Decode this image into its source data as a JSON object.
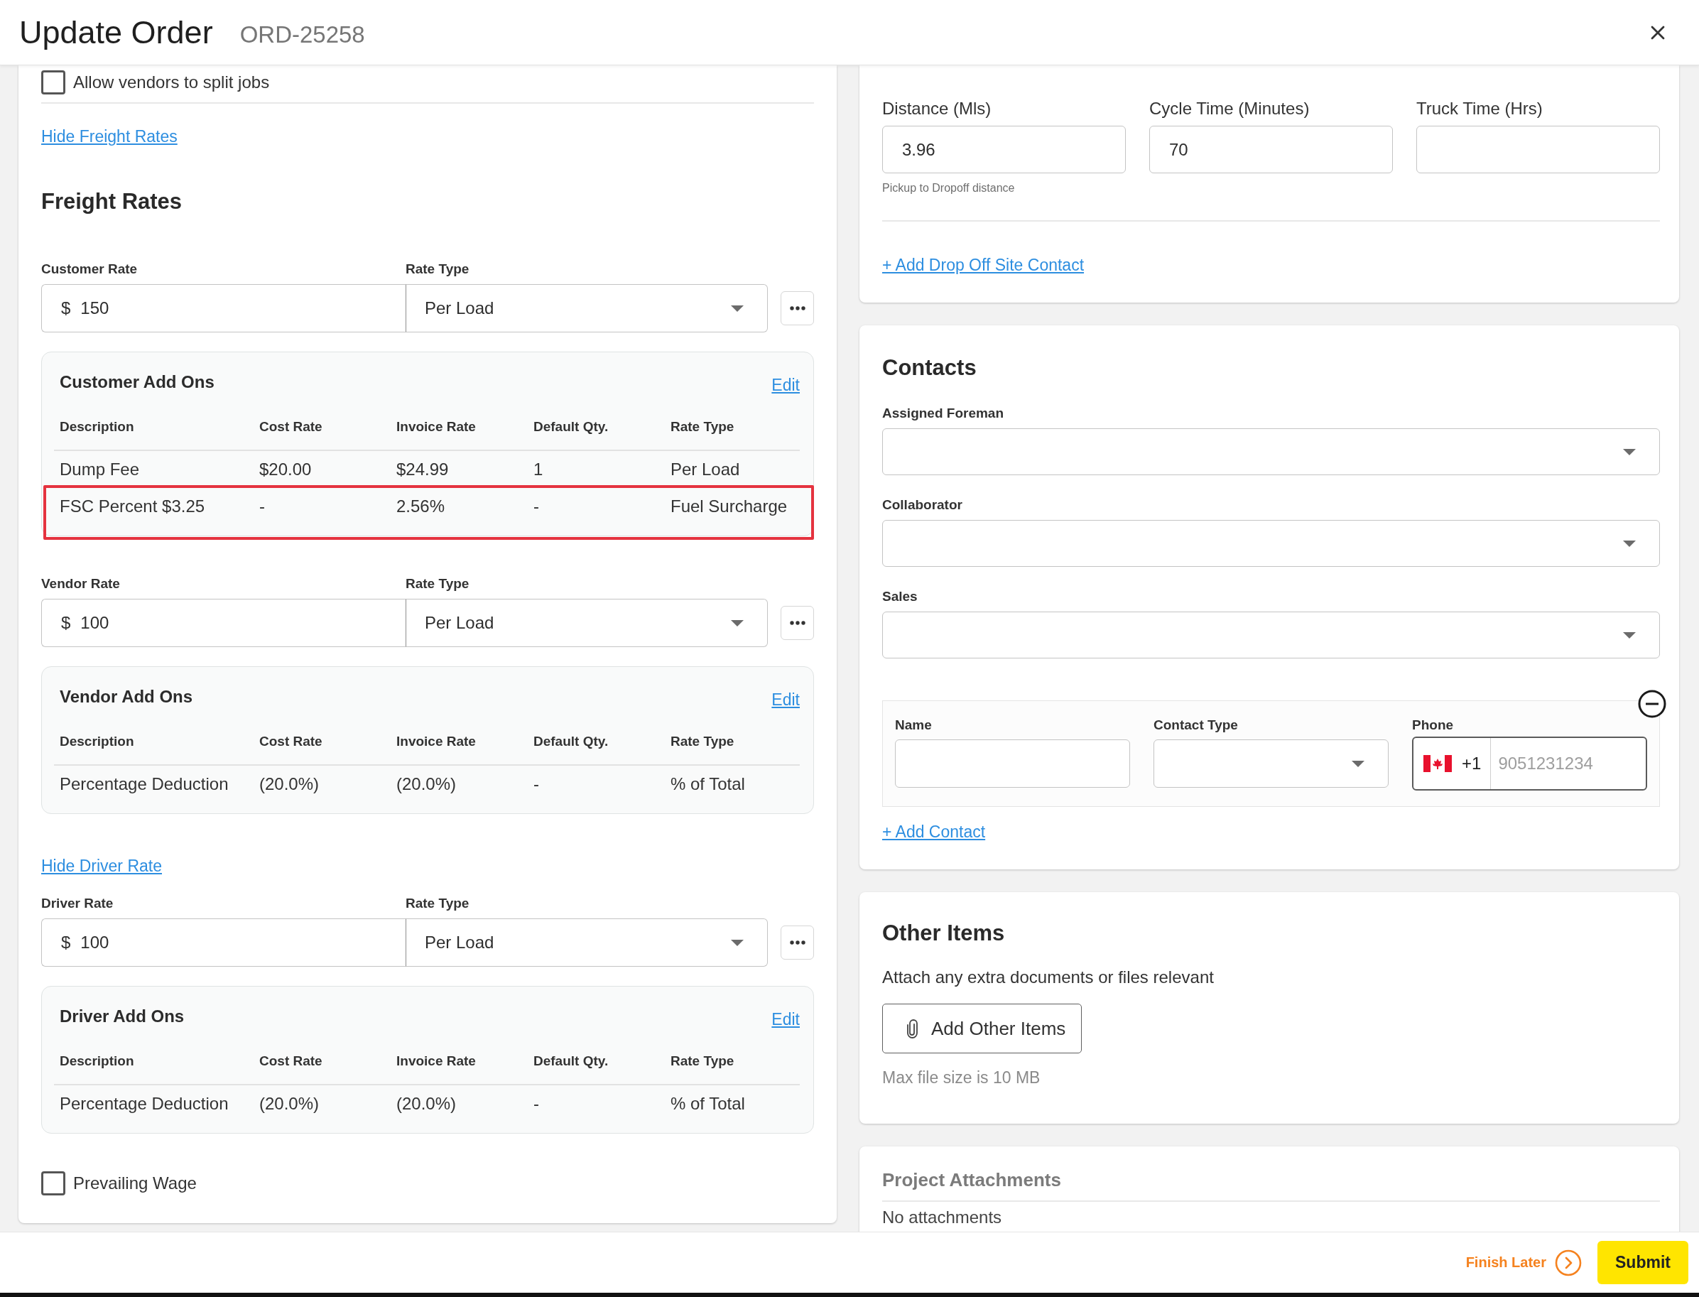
{
  "dialog": {
    "title": "Update Order",
    "order_number": "ORD-25258"
  },
  "freight": {
    "split_jobs": {
      "label": "Allow vendors to split jobs",
      "checked": false
    },
    "toggle_link": "Hide Freight Rates",
    "title": "Freight Rates",
    "rate_groups": [
      {
        "rate_label": "Customer Rate",
        "currency": "$",
        "amount": "150",
        "type_label": "Rate Type",
        "type": "Per Load",
        "addons": {
          "title": "Customer Add Ons",
          "edit": "Edit",
          "columns": [
            "Description",
            "Cost Rate",
            "Invoice Rate",
            "Default Qty.",
            "Rate Type"
          ],
          "rows": [
            {
              "cells": [
                "Dump Fee",
                "$20.00",
                "$24.99",
                "1",
                "Per Load"
              ],
              "highlighted": false
            },
            {
              "cells": [
                "FSC Percent $3.25",
                "-",
                "2.56%",
                "-",
                "Fuel Surcharge"
              ],
              "highlighted": true
            }
          ]
        }
      },
      {
        "rate_label": "Vendor Rate",
        "currency": "$",
        "amount": "100",
        "type_label": "Rate Type",
        "type": "Per Load",
        "addons": {
          "title": "Vendor Add Ons",
          "edit": "Edit",
          "columns": [
            "Description",
            "Cost Rate",
            "Invoice Rate",
            "Default Qty.",
            "Rate Type"
          ],
          "rows": [
            {
              "cells": [
                "Percentage Deduction",
                "(20.0%)",
                "(20.0%)",
                "-",
                "% of Total"
              ],
              "highlighted": false
            }
          ]
        }
      },
      {
        "toggle_link": "Hide Driver Rate",
        "rate_label": "Driver Rate",
        "currency": "$",
        "amount": "100",
        "type_label": "Rate Type",
        "type": "Per Load",
        "addons": {
          "title": "Driver Add Ons",
          "edit": "Edit",
          "columns": [
            "Description",
            "Cost Rate",
            "Invoice Rate",
            "Default Qty.",
            "Rate Type"
          ],
          "rows": [
            {
              "cells": [
                "Percentage Deduction",
                "(20.0%)",
                "(20.0%)",
                "-",
                "% of Total"
              ],
              "highlighted": false
            }
          ]
        }
      }
    ],
    "prevailing_wage": {
      "label": "Prevailing Wage",
      "checked": false
    }
  },
  "trip": {
    "fields": [
      {
        "label": "Distance (Mls)",
        "value": "3.96",
        "helper": "Pickup to Dropoff distance"
      },
      {
        "label": "Cycle Time (Minutes)",
        "value": "70"
      },
      {
        "label": "Truck Time (Hrs)"
      }
    ],
    "add_link": "+ Add Drop Off Site Contact"
  },
  "contacts": {
    "title": "Contacts",
    "selects": [
      {
        "label": "Assigned Foreman"
      },
      {
        "label": "Collaborator"
      },
      {
        "label": "Sales"
      }
    ],
    "entries": [
      {
        "name_label": "Name",
        "type_label": "Contact Type",
        "phone_label": "Phone",
        "dial_code": "+1",
        "phone_placeholder": "9051231234",
        "phone_focused": true
      }
    ],
    "add_link": "+ Add Contact"
  },
  "other_items": {
    "title": "Other Items",
    "description": "Attach any extra documents or files relevant",
    "button": "Add Other Items",
    "note": "Max file size is 10 MB"
  },
  "attachments": {
    "title": "Project Attachments",
    "empty_text": "No attachments"
  },
  "footer": {
    "finish_later": "Finish Later",
    "submit": "Submit"
  }
}
